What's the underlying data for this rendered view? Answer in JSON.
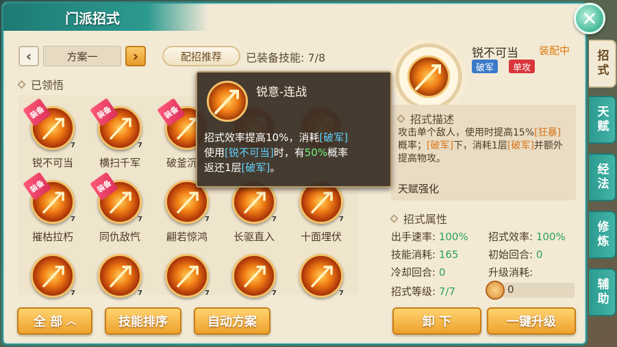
{
  "window": {
    "title": "门派招式",
    "close_icon": "close-icon"
  },
  "scheme": {
    "current": "方案一",
    "recommend_label": "配招推荐",
    "equipped_label": "已装备技能: 7/8"
  },
  "sections": {
    "learned": "已领悟"
  },
  "skills": [
    {
      "name": "锐不可当",
      "level": "7",
      "equipped": true,
      "tag": "装备"
    },
    {
      "name": "横扫千军",
      "level": "7",
      "equipped": true,
      "tag": "装备"
    },
    {
      "name": "破釜沉舟",
      "level": "7",
      "equipped": true,
      "tag": "装备"
    },
    {
      "name": "",
      "level": "7",
      "equipped": false
    },
    {
      "name": "",
      "level": "7",
      "equipped": false
    },
    {
      "name": "摧枯拉朽",
      "level": "7",
      "equipped": true,
      "tag": "装备"
    },
    {
      "name": "同仇敌忾",
      "level": "7",
      "equipped": true,
      "tag": "装备"
    },
    {
      "name": "翩若惊鸿",
      "level": "7",
      "equipped": false
    },
    {
      "name": "长驱直入",
      "level": "7",
      "equipped": false
    },
    {
      "name": "十面埋伏",
      "level": "7",
      "equipped": false
    },
    {
      "name": "",
      "level": "7",
      "equipped": false
    },
    {
      "name": "",
      "level": "7",
      "equipped": false
    },
    {
      "name": "",
      "level": "7",
      "equipped": false
    },
    {
      "name": "",
      "level": "7",
      "equipped": false
    },
    {
      "name": "",
      "level": "7",
      "equipped": false
    }
  ],
  "buttons": {
    "all": "全 部",
    "sort": "技能排序",
    "auto": "自动方案",
    "unequip": "卸 下",
    "upgrade": "一键升级"
  },
  "tooltip": {
    "title": "锐意-连战",
    "line1_pre": "招式效率提高10%，消耗",
    "line1_hl": "[破军]",
    "line2_pre": "使用",
    "line2_hl": "[锐不可当]",
    "line2_mid": "时，有",
    "line2_pct": "50%",
    "line2_post": "概率",
    "line3_pre": "返还1层",
    "line3_hl": "[破军]",
    "line3_post": "。"
  },
  "detail": {
    "name": "锐不可当",
    "status": "装配中",
    "badge1": "破军",
    "badge2": "单攻",
    "desc_title": "招式描述",
    "desc_p1": "攻击单个敌人，使用时提高15%",
    "desc_hl1": "[狂暴]",
    "desc_p2": "概率；",
    "desc_hl2": "[破军]",
    "desc_p3": "下，消耗1层",
    "desc_hl3": "[破军]",
    "desc_p4": "并额外提高物攻。",
    "talent_title": "天赋强化",
    "attr_title": "招式属性",
    "attrs": {
      "speed_label": "出手速率:",
      "speed_val": "100%",
      "eff_label": "招式效率:",
      "eff_val": "100%",
      "cost_label": "技能消耗:",
      "cost_val": "165",
      "init_label": "初始回合:",
      "init_val": "0",
      "cd_label": "冷却回合:",
      "cd_val": "0",
      "upcost_label": "升级消耗:",
      "level_label": "招式等级:",
      "level_val": "7/7",
      "coin_val": "0"
    }
  },
  "side_tabs": [
    "招式",
    "天赋",
    "经法",
    "修炼",
    "辅助"
  ],
  "colors": {
    "teal": "#2c9a90",
    "orange": "#eea22e",
    "green_value": "#2aa05e"
  }
}
